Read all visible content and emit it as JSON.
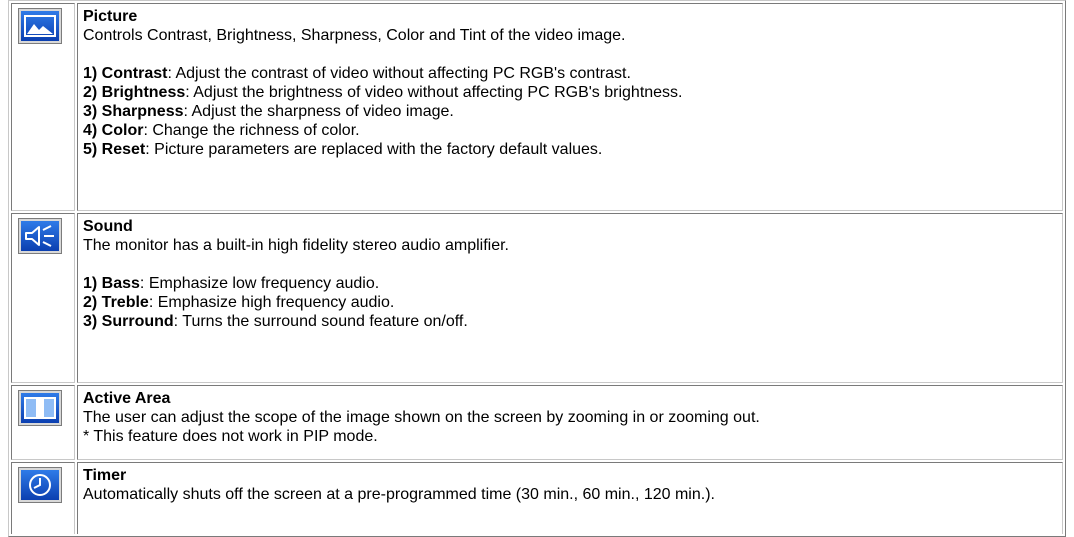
{
  "colors": {
    "icon_frame": "#7c7c7c",
    "icon_blue_dark": "#0b3fb0",
    "icon_blue_light": "#2f7be8",
    "icon_glyph": "#ffffff"
  },
  "sections": [
    {
      "icon": "picture-icon",
      "title": "Picture",
      "description": "Controls Contrast, Brightness, Sharpness, Color and Tint of the video image.",
      "items": [
        {
          "label": "1) Contrast",
          "text": ": Adjust the contrast of video without affecting PC RGB's contrast."
        },
        {
          "label": "2) Brightness",
          "text": ": Adjust the brightness of video without affecting PC RGB's brightness."
        },
        {
          "label": "3) Sharpness",
          "text": ": Adjust the sharpness of video image."
        },
        {
          "label": "4) Color",
          "text": ": Change the richness of color."
        },
        {
          "label": "5) Reset",
          "text": ": Picture parameters are replaced with the factory default values."
        }
      ]
    },
    {
      "icon": "speaker-icon",
      "title": "Sound",
      "description": "The monitor has a built-in high fidelity stereo audio amplifier.",
      "items": [
        {
          "label": "1) Bass",
          "text": ": Emphasize low frequency audio."
        },
        {
          "label": "2) Treble",
          "text": ": Emphasize high frequency audio."
        },
        {
          "label": "3) Surround",
          "text": ": Turns the surround sound feature on/off."
        }
      ]
    },
    {
      "icon": "active-area-icon",
      "title": "Active Area",
      "description": "The user can adjust the scope of the image shown on the screen by zooming in or zooming out.",
      "note": "* This feature does not work in PIP mode."
    },
    {
      "icon": "clock-icon",
      "title": "Timer",
      "description": "Automatically shuts off the screen at a pre-programmed time (30 min., 60 min., 120 min.)."
    }
  ]
}
